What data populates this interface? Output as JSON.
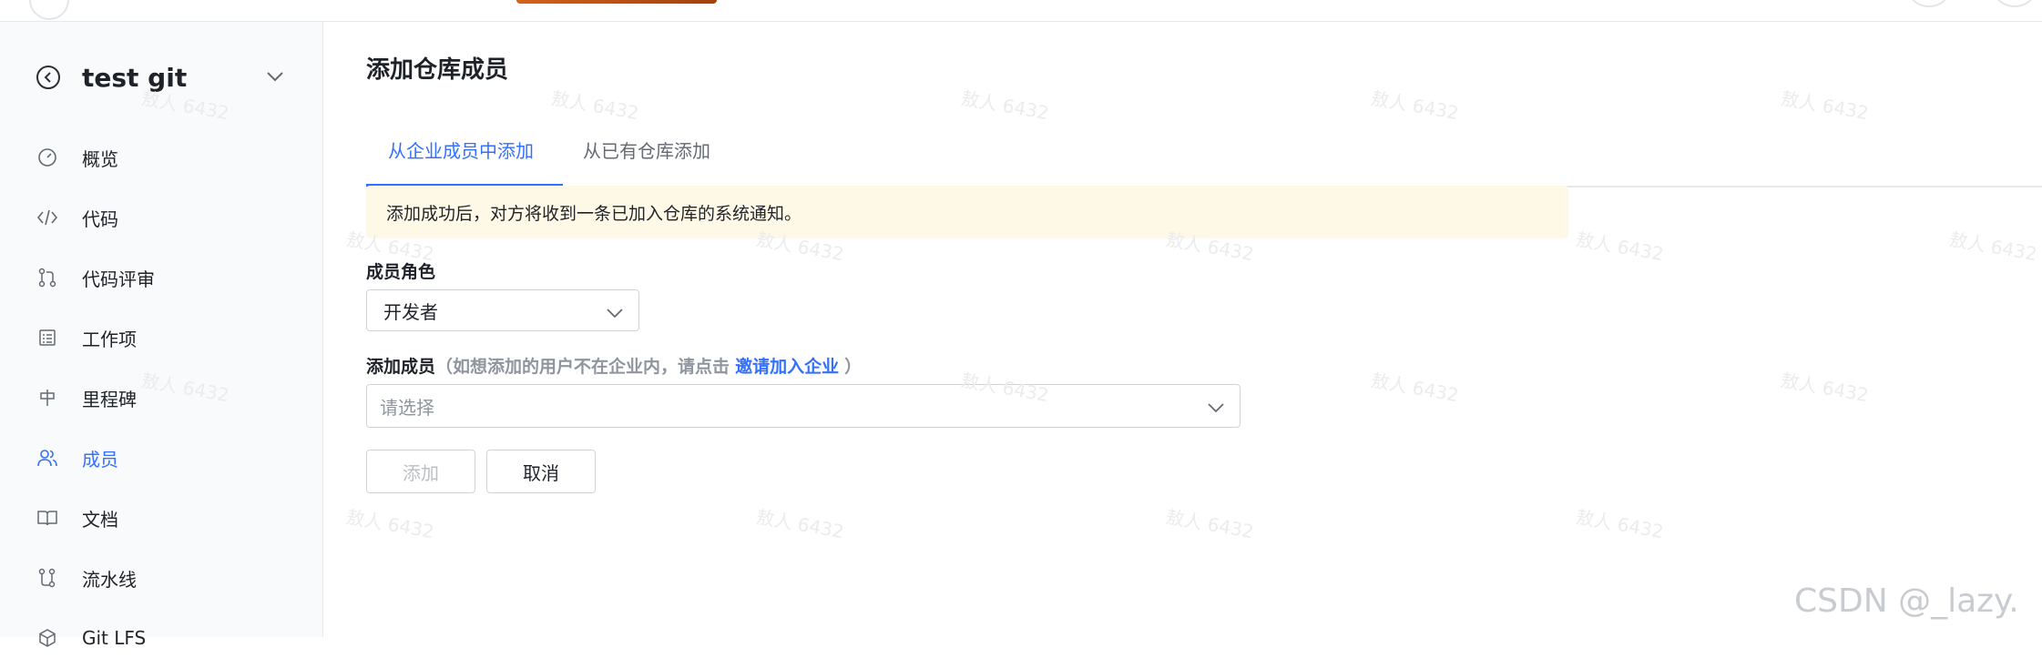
{
  "sidebar": {
    "repo_name": "test git",
    "items": [
      {
        "label": "概览",
        "icon": "gauge-icon"
      },
      {
        "label": "代码",
        "icon": "code-icon"
      },
      {
        "label": "代码评审",
        "icon": "pull-request-icon"
      },
      {
        "label": "工作项",
        "icon": "task-list-icon"
      },
      {
        "label": "里程碑",
        "icon": "milestone-icon"
      },
      {
        "label": "成员",
        "icon": "members-icon",
        "active": true
      },
      {
        "label": "文档",
        "icon": "book-icon"
      },
      {
        "label": "流水线",
        "icon": "pipeline-icon"
      },
      {
        "label": "Git LFS",
        "icon": "package-icon"
      }
    ]
  },
  "main": {
    "title": "添加仓库成员",
    "tabs": [
      {
        "label": "从企业成员中添加",
        "active": true
      },
      {
        "label": "从已有仓库添加",
        "active": false
      }
    ],
    "notice": "添加成功后，对方将收到一条已加入仓库的系统通知。",
    "role": {
      "label": "成员角色",
      "value": "开发者"
    },
    "member": {
      "label": "添加成员",
      "hint_prefix": "（如想添加的用户不在企业内，请点击",
      "link": "邀请加入企业",
      "hint_suffix": "）",
      "placeholder": "请选择"
    },
    "buttons": {
      "add": "添加",
      "cancel": "取消"
    }
  },
  "watermark": "敖人 6432",
  "footer_watermark": "CSDN @_lazy.",
  "colors": {
    "accent": "#3370ff",
    "notice_bg": "#fdf9e6",
    "sidebar_bg": "#f8fafb"
  }
}
